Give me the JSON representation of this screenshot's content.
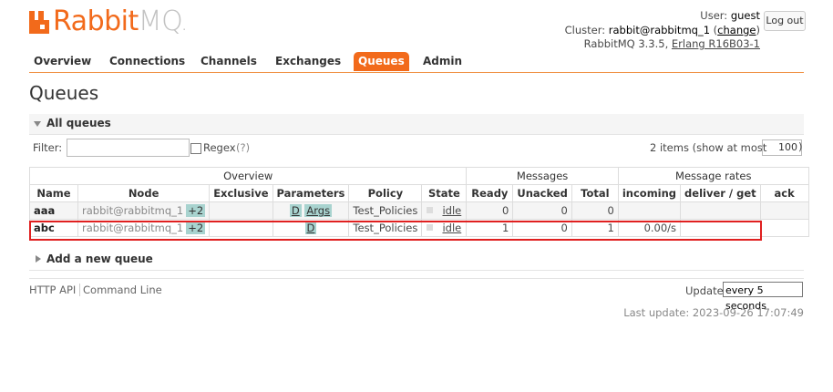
{
  "brand": {
    "name_part1": "Rabbit",
    "name_part2": "MQ",
    "accent": "#f26a1b"
  },
  "login": {
    "user_label": "User:",
    "user": "guest",
    "cluster_label": "Cluster:",
    "cluster": "rabbit@rabbitmq_1",
    "change_open": "(",
    "change_link": "change",
    "change_close": ")",
    "version": "RabbitMQ 3.3.5,",
    "erlang": "Erlang R16B03-1",
    "logout": "Log out"
  },
  "tabs": [
    "Overview",
    "Connections",
    "Channels",
    "Exchanges",
    "Queues",
    "Admin"
  ],
  "active_tab": "Queues",
  "page_title": "Queues",
  "all_queues": {
    "title": "All queues",
    "filter_label": "Filter:",
    "filter_value": "",
    "regex_label": "Regex",
    "regex_help": "(?)",
    "items_text": "2 items (show at most",
    "page_size": "100",
    "page_size_end": ")"
  },
  "table": {
    "groups": [
      "Overview",
      "Messages",
      "Message rates"
    ],
    "columns": [
      "Name",
      "Node",
      "Exclusive",
      "Parameters",
      "Policy",
      "State",
      "Ready",
      "Unacked",
      "Total",
      "incoming",
      "deliver / get",
      "ack"
    ],
    "rows": [
      {
        "name": "aaa",
        "node": "rabbit@rabbitmq_1",
        "node_extra": "+2",
        "exclusive": "",
        "params": [
          "D",
          "Args"
        ],
        "policy": "Test_Policies",
        "state": "idle",
        "ready": "0",
        "unacked": "0",
        "total": "0",
        "incoming": "",
        "deliver_get": "",
        "ack": ""
      },
      {
        "name": "abc",
        "node": "rabbit@rabbitmq_1",
        "node_extra": "+2",
        "exclusive": "",
        "params": [
          "D"
        ],
        "policy": "Test_Policies",
        "state": "idle",
        "ready": "1",
        "unacked": "0",
        "total": "1",
        "incoming": "0.00/s",
        "deliver_get": "",
        "ack": ""
      }
    ]
  },
  "add_queue": {
    "title": "Add a new queue"
  },
  "footer": {
    "http_api": "HTTP API",
    "command_line": "Command Line",
    "update_label": "Update",
    "update_value": "every 5 seconds",
    "last_update": "Last update: 2023-09-26 17:07:49"
  }
}
